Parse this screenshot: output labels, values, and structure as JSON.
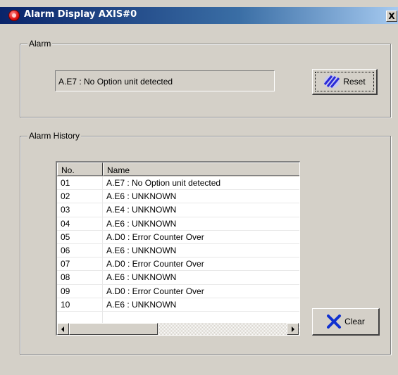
{
  "window": {
    "title": "Alarm Display AXIS#0",
    "close_glyph": "X",
    "icon": "red-alarm-icon"
  },
  "alarm": {
    "group_label": "Alarm",
    "current_alarm": "A.E7 : No Option unit detected",
    "reset_label": "Reset",
    "reset_icon": "reset-stripes-icon"
  },
  "history": {
    "group_label": "Alarm History",
    "columns": [
      "No.",
      "Name"
    ],
    "rows": [
      {
        "no": "01",
        "name": "A.E7 : No Option unit detected"
      },
      {
        "no": "02",
        "name": "A.E6 : UNKNOWN"
      },
      {
        "no": "03",
        "name": "A.E4 : UNKNOWN"
      },
      {
        "no": "04",
        "name": "A.E6 : UNKNOWN"
      },
      {
        "no": "05",
        "name": "A.D0 : Error Counter Over"
      },
      {
        "no": "06",
        "name": "A.E6 : UNKNOWN"
      },
      {
        "no": "07",
        "name": "A.D0 : Error Counter Over"
      },
      {
        "no": "08",
        "name": "A.E6 : UNKNOWN"
      },
      {
        "no": "09",
        "name": "A.D0 : Error Counter Over"
      },
      {
        "no": "10",
        "name": "A.E6 : UNKNOWN"
      }
    ],
    "clear_label": "Clear",
    "clear_icon": "blue-x-icon"
  },
  "colors": {
    "dialog_bg": "#d4d0c8",
    "title_start": "#0a246a",
    "title_end": "#a6caf0",
    "clear_x": "#1030d0"
  }
}
